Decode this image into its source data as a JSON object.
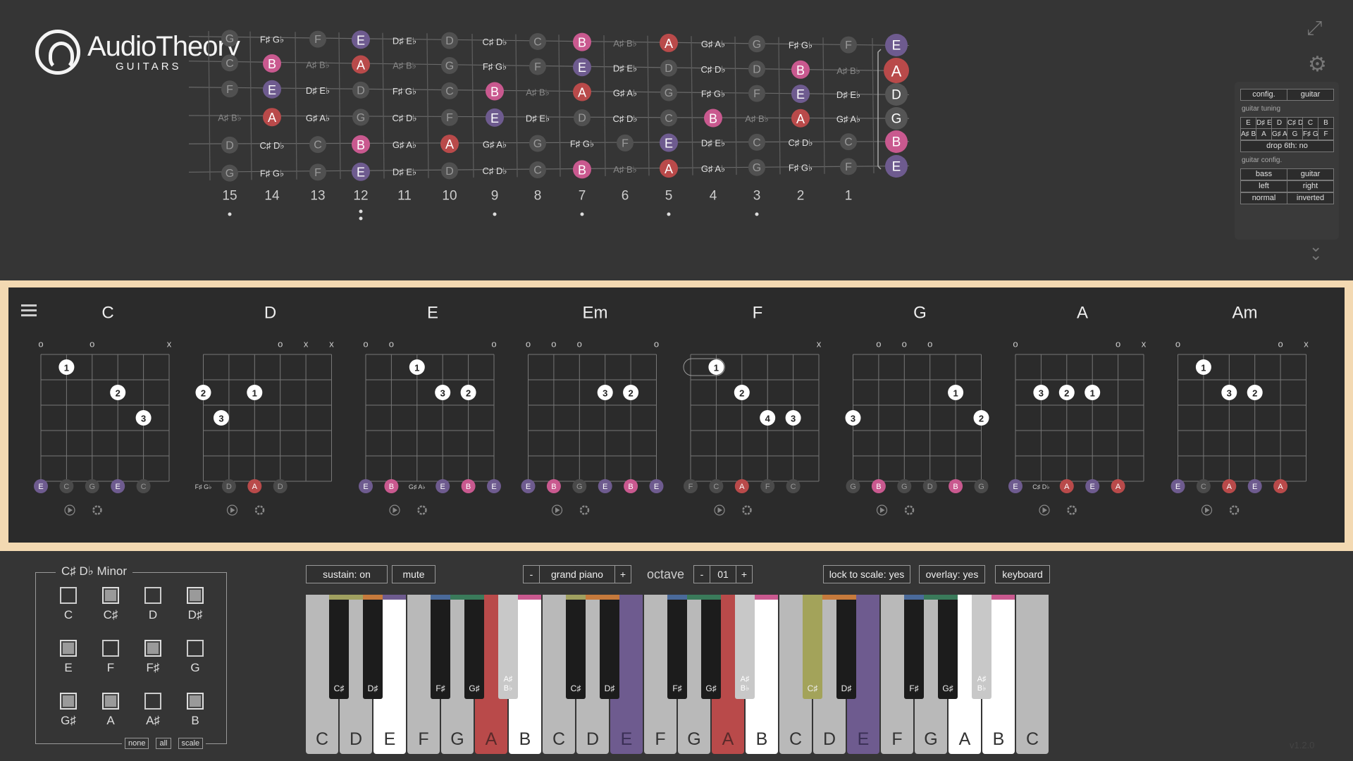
{
  "app": {
    "brand": "AudioTheory",
    "subtitle": "GUITARS",
    "version": "v1.2.0"
  },
  "colors": {
    "E": "#6e5b8f",
    "A": "#b94a4a",
    "B": "#c9598f",
    "neutral": "#5a5a5a",
    "panel_border": "#f3d9b2"
  },
  "fretboard": {
    "fret_numbers": [
      "15",
      "14",
      "13",
      "12",
      "11",
      "10",
      "9",
      "8",
      "7",
      "6",
      "5",
      "4",
      "3",
      "2",
      "1"
    ],
    "inlay_frets": [
      "15",
      "12",
      "9",
      "7",
      "5",
      "3"
    ],
    "strings": [
      {
        "open": "E",
        "notes": [
          "G",
          "F♯ G♭",
          "F",
          "E",
          "D♯ E♭",
          "D",
          "C♯ D♭",
          "C",
          "B",
          "A♯ B♭",
          "A",
          "G♯ A♭",
          "G",
          "F♯ G♭",
          "F"
        ]
      },
      {
        "open": "A",
        "notes": [
          "C",
          "B",
          "A♯ B♭",
          "A",
          "A♯ B♭",
          "G",
          "F♯ G♭",
          "F",
          "E",
          "D♯ E♭",
          "D",
          "C♯ D♭",
          "D",
          "B",
          "A♯ B♭"
        ]
      },
      {
        "open": "D",
        "notes": [
          "F",
          "E",
          "D♯ E♭",
          "D",
          "F♯ G♭",
          "C",
          "B",
          "A♯ B♭",
          "A",
          "G♯ A♭",
          "G",
          "F♯ G♭",
          "F",
          "E",
          "D♯ E♭"
        ]
      },
      {
        "open": "G",
        "notes": [
          "A♯ B♭",
          "A",
          "G♯ A♭",
          "G",
          "C♯ D♭",
          "F",
          "E",
          "D♯ E♭",
          "D",
          "C♯ D♭",
          "C",
          "B",
          "A♯ B♭",
          "A",
          "G♯ A♭"
        ]
      },
      {
        "open": "B",
        "notes": [
          "D",
          "C♯ D♭",
          "C",
          "B",
          "G♯ A♭",
          "A",
          "G♯ A♭",
          "G",
          "F♯ G♭",
          "F",
          "E",
          "D♯ E♭",
          "C",
          "C♯ D♭",
          "C"
        ]
      },
      {
        "open": "E",
        "notes": [
          "G",
          "F♯ G♭",
          "F",
          "E",
          "D♯ E♭",
          "D",
          "C♯ D♭",
          "C",
          "B",
          "A♯ B♭",
          "A",
          "G♯ A♭",
          "G",
          "F♯ G♭",
          "F"
        ]
      }
    ]
  },
  "config_panel": {
    "tabs": [
      "config.",
      "guitar"
    ],
    "tuning_label": "guitar tuning",
    "tuning_grid": [
      "E",
      "D♯ E♭",
      "D",
      "C♯ D♭",
      "C",
      "B",
      "A♯ B♭",
      "A",
      "G♯ A♭",
      "G",
      "F♯ G♭",
      "F"
    ],
    "drop6": "drop 6th: no",
    "config_label": "guitar config.",
    "config_rows": [
      [
        "bass",
        "guitar"
      ],
      [
        "left",
        "right"
      ],
      [
        "normal",
        "inverted"
      ]
    ]
  },
  "chords": [
    {
      "name": "C",
      "markers": [
        "o",
        "",
        "o",
        "",
        "",
        "x"
      ],
      "fingers": [
        {
          "s": 1,
          "f": 1,
          "n": "1"
        },
        {
          "s": 3,
          "f": 2,
          "n": "2"
        },
        {
          "s": 4,
          "f": 3,
          "n": "3"
        }
      ],
      "notes": [
        "E",
        "C",
        "G",
        "E",
        "C"
      ]
    },
    {
      "name": "D",
      "markers": [
        "",
        "",
        "",
        "o",
        "x",
        "x"
      ],
      "fingers": [
        {
          "s": -1,
          "f": 2,
          "n": "2"
        },
        {
          "s": 2,
          "f": 2,
          "n": "1"
        },
        {
          "s": 0.7,
          "f": 3,
          "n": "3"
        }
      ],
      "notes": [
        "F♯ G♭",
        "D",
        "A",
        "D"
      ]
    },
    {
      "name": "E",
      "markers": [
        "o",
        "o",
        "",
        "",
        "",
        "o"
      ],
      "fingers": [
        {
          "s": 2,
          "f": 1,
          "n": "1"
        },
        {
          "s": 3,
          "f": 2,
          "n": "3"
        },
        {
          "s": 4,
          "f": 2,
          "n": "2"
        }
      ],
      "notes": [
        "E",
        "B",
        "G♯ A♭",
        "E",
        "B",
        "E"
      ]
    },
    {
      "name": "Em",
      "markers": [
        "o",
        "o",
        "o",
        "",
        "",
        "o"
      ],
      "fingers": [
        {
          "s": 3,
          "f": 2,
          "n": "3"
        },
        {
          "s": 4,
          "f": 2,
          "n": "2"
        }
      ],
      "notes": [
        "E",
        "B",
        "G",
        "E",
        "B",
        "E"
      ]
    },
    {
      "name": "F",
      "markers": [
        "",
        "",
        "",
        "",
        "",
        "x"
      ],
      "fingers": [
        {
          "s": 1,
          "f": 1,
          "n": "1"
        },
        {
          "s": 2,
          "f": 2,
          "n": "2"
        },
        {
          "s": 3,
          "f": 3,
          "n": "4"
        },
        {
          "s": 4,
          "f": 3,
          "n": "3"
        }
      ],
      "notes": [
        "F",
        "C",
        "A",
        "F",
        "C"
      ]
    },
    {
      "name": "G",
      "markers": [
        "",
        "o",
        "o",
        "o",
        "",
        ""
      ],
      "fingers": [
        {
          "s": -1,
          "f": 3,
          "n": "3"
        },
        {
          "s": 4,
          "f": 2,
          "n": "1"
        },
        {
          "s": 5,
          "f": 3,
          "n": "2"
        }
      ],
      "notes": [
        "G",
        "B",
        "G",
        "D",
        "B",
        "G"
      ]
    },
    {
      "name": "A",
      "markers": [
        "o",
        "",
        "",
        "",
        "o",
        "x"
      ],
      "fingers": [
        {
          "s": 1,
          "f": 2,
          "n": "3"
        },
        {
          "s": 2,
          "f": 2,
          "n": "2"
        },
        {
          "s": 3,
          "f": 2,
          "n": "1"
        }
      ],
      "notes": [
        "E",
        "C♯ D♭",
        "A",
        "E",
        "A"
      ]
    },
    {
      "name": "Am",
      "markers": [
        "o",
        "",
        "",
        "",
        "o",
        "x"
      ],
      "fingers": [
        {
          "s": 1,
          "f": 1,
          "n": "1"
        },
        {
          "s": 2,
          "f": 2,
          "n": "3"
        },
        {
          "s": 3,
          "f": 2,
          "n": "2"
        }
      ],
      "notes": [
        "E",
        "C",
        "A",
        "E",
        "A"
      ]
    }
  ],
  "scale": {
    "title": "C♯ D♭ Minor",
    "notes": [
      {
        "label": "C",
        "on": false
      },
      {
        "label": "C♯",
        "on": true
      },
      {
        "label": "D",
        "on": false
      },
      {
        "label": "D♯",
        "on": true
      },
      {
        "label": "E",
        "on": true
      },
      {
        "label": "F",
        "on": false
      },
      {
        "label": "F♯",
        "on": true
      },
      {
        "label": "G",
        "on": false
      },
      {
        "label": "G♯",
        "on": true
      },
      {
        "label": "A",
        "on": true
      },
      {
        "label": "A♯",
        "on": false
      },
      {
        "label": "B",
        "on": true
      }
    ],
    "buttons": [
      "none",
      "all",
      "scale"
    ]
  },
  "controls": {
    "sustain": "sustain: on",
    "mute": "mute",
    "minus": "-",
    "plus": "+",
    "instrument": "grand piano",
    "octave_label": "octave",
    "octave_value": "01",
    "lock": "lock to scale: yes",
    "overlay": "overlay: yes",
    "keyboard": "keyboard"
  },
  "keyboard": {
    "white": [
      {
        "n": "C",
        "c": "#b9b9b9",
        "s": ""
      },
      {
        "n": "D",
        "c": "#b9b9b9",
        "s": "#a0a060"
      },
      {
        "n": "E",
        "c": "#ffffff",
        "s": "#6e5b8f"
      },
      {
        "n": "F",
        "c": "#b9b9b9",
        "s": ""
      },
      {
        "n": "G",
        "c": "#b9b9b9",
        "s": "#3a7a5a"
      },
      {
        "n": "A",
        "c": "#b94a4a",
        "s": ""
      },
      {
        "n": "B",
        "c": "#ffffff",
        "s": "#c9598f"
      },
      {
        "n": "C",
        "c": "#b9b9b9",
        "s": ""
      },
      {
        "n": "D",
        "c": "#b9b9b9",
        "s": "#c67a3c"
      },
      {
        "n": "E",
        "c": "#6e5b8f",
        "s": ""
      },
      {
        "n": "F",
        "c": "#b9b9b9",
        "s": ""
      },
      {
        "n": "G",
        "c": "#b9b9b9",
        "s": "#3a7a5a"
      },
      {
        "n": "A",
        "c": "#b94a4a",
        "s": ""
      },
      {
        "n": "B",
        "c": "#ffffff",
        "s": "#c9598f"
      },
      {
        "n": "C",
        "c": "#b9b9b9",
        "s": ""
      },
      {
        "n": "D",
        "c": "#b9b9b9",
        "s": "#c67a3c"
      },
      {
        "n": "E",
        "c": "#6e5b8f",
        "s": ""
      },
      {
        "n": "F",
        "c": "#b9b9b9",
        "s": ""
      },
      {
        "n": "G",
        "c": "#b9b9b9",
        "s": "#3a7a5a"
      },
      {
        "n": "A",
        "c": "#ffffff",
        "s": ""
      },
      {
        "n": "B",
        "c": "#ffffff",
        "s": "#c9598f"
      },
      {
        "n": "C",
        "c": "#b9b9b9",
        "s": ""
      }
    ],
    "black": [
      {
        "n": "C♯",
        "c": "#1c1c1c",
        "s": "#a0a060",
        "after": 0
      },
      {
        "n": "D♯",
        "c": "#1c1c1c",
        "s": "#c67a3c",
        "after": 1
      },
      {
        "n": "F♯",
        "c": "#1c1c1c",
        "s": "#4a6a9a",
        "after": 3
      },
      {
        "n": "G♯",
        "c": "#1c1c1c",
        "s": "#3a7a5a",
        "after": 4
      },
      {
        "n": "A♯ B♭",
        "c": "#c8c8c8",
        "s": "",
        "after": 5
      },
      {
        "n": "C♯",
        "c": "#1c1c1c",
        "s": "#a0a060",
        "after": 7
      },
      {
        "n": "D♯",
        "c": "#1c1c1c",
        "s": "#c67a3c",
        "after": 8
      },
      {
        "n": "F♯",
        "c": "#1c1c1c",
        "s": "#4a6a9a",
        "after": 10
      },
      {
        "n": "G♯",
        "c": "#1c1c1c",
        "s": "#3a7a5a",
        "after": 11
      },
      {
        "n": "A♯ B♭",
        "c": "#c8c8c8",
        "s": "",
        "after": 12
      },
      {
        "n": "C♯",
        "c": "#a3a35a",
        "s": "",
        "after": 14
      },
      {
        "n": "D♯",
        "c": "#1c1c1c",
        "s": "#c67a3c",
        "after": 15
      },
      {
        "n": "F♯",
        "c": "#1c1c1c",
        "s": "#4a6a9a",
        "after": 17
      },
      {
        "n": "G♯",
        "c": "#1c1c1c",
        "s": "#3a7a5a",
        "after": 18
      },
      {
        "n": "A♯ B♭",
        "c": "#c8c8c8",
        "s": "",
        "after": 19
      }
    ]
  }
}
